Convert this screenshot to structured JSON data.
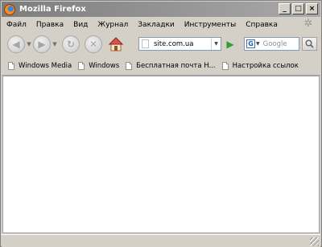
{
  "window": {
    "title": "Mozilla Firefox",
    "buttons": [
      "_",
      "□",
      "×"
    ]
  },
  "menu": [
    "Файл",
    "Правка",
    "Вид",
    "Журнал",
    "Закладки",
    "Инструменты",
    "Справка"
  ],
  "nav": {
    "url": "site.com.ua",
    "search_placeholder": "Google"
  },
  "bookmarks": [
    "Windows Media",
    "Windows",
    "Бесплатная почта H...",
    "Настройка ссылок"
  ]
}
